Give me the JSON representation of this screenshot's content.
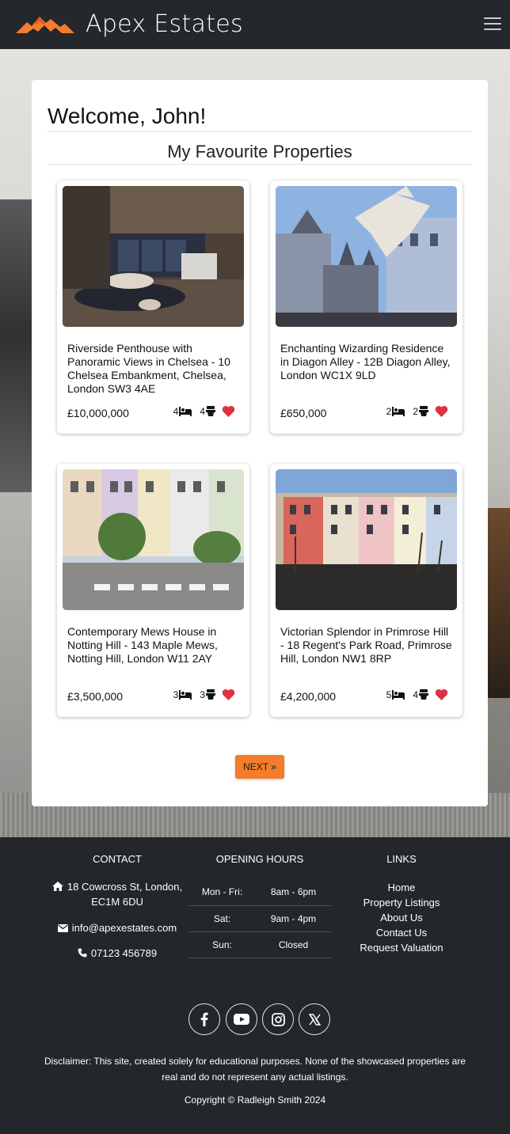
{
  "header": {
    "brand": "Apex Estates",
    "logo_icon": "mountain-logo-icon",
    "menu_icon": "hamburger-menu-icon",
    "accent_color": "#f47c2a"
  },
  "main": {
    "welcome": "Welcome, John!",
    "section_title": "My Favourite Properties",
    "properties": [
      {
        "title": "Riverside Penthouse with Panoramic Views in Chelsea - 10 Chelsea Embankment, Chelsea, London SW3 4AE",
        "price": "£10,000,000",
        "beds": "4",
        "baths": "4",
        "image": "modern-penthouse-interior"
      },
      {
        "title": "Enchanting Wizarding Residence in Diagon Alley - 12B Diagon Alley, London WC1X 9LD",
        "price": "£650,000",
        "beds": "2",
        "baths": "2",
        "image": "gothic-building-with-dragon"
      },
      {
        "title": "Contemporary Mews House in Notting Hill - 143 Maple Mews, Notting Hill, London W11 2AY",
        "price": "£3,500,000",
        "beds": "3",
        "baths": "3",
        "image": "pastel-terraced-houses-street"
      },
      {
        "title": "Victorian Splendor in Primrose Hill - 18 Regent's Park Road, Primrose Hill, London NW1 8RP",
        "price": "£4,200,000",
        "beds": "5",
        "baths": "4",
        "image": "colourful-victorian-terrace-park"
      }
    ],
    "next_label": "NEXT »",
    "heart_color": "#e0313f"
  },
  "footer": {
    "contact_heading": "CONTACT",
    "address_line1": "18 Cowcross St, London,",
    "address_line2": "EC1M 6DU",
    "email": "info@apexestates.com",
    "phone": "07123 456789",
    "hours_heading": "OPENING HOURS",
    "hours": [
      {
        "day": "Mon - Fri:",
        "time": "8am - 6pm"
      },
      {
        "day": "Sat:",
        "time": "9am - 4pm"
      },
      {
        "day": "Sun:",
        "time": "Closed"
      }
    ],
    "links_heading": "LINKS",
    "links": [
      "Home",
      "Property Listings",
      "About Us",
      "Contact Us",
      "Request Valuation"
    ],
    "social_icons": [
      "facebook-icon",
      "youtube-icon",
      "instagram-icon",
      "x-icon"
    ],
    "disclaimer": "Disclaimer: This site, created solely for educational purposes. None of the showcased properties are real and do not represent any actual listings.",
    "copyright": "Copyright © Radleigh Smith 2024"
  }
}
